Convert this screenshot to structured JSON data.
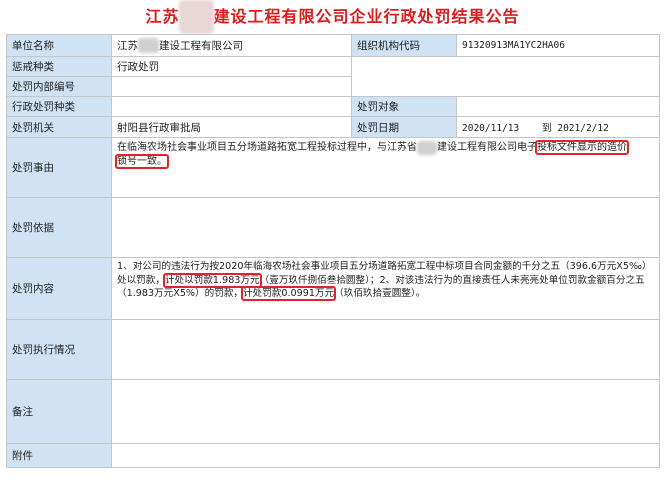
{
  "title": {
    "prefix": "江苏",
    "masked": "某某",
    "suffix": "建设工程有限公司企业行政处罚结果公告"
  },
  "rows": {
    "unit_name_label": "单位名称",
    "unit_name_prefix": "江苏",
    "unit_name_masked": "某某",
    "unit_name_suffix": "建设工程有限公司",
    "org_code_label": "组织机构代码",
    "org_code_value": "91320913MA1YC2HA06",
    "punish_type_label": "惩戒种类",
    "punish_type_value": "行政处罚",
    "internal_no_label": "处罚内部编号",
    "internal_no_value": "",
    "admin_type_label": "行政处罚种类",
    "admin_type_value": "",
    "target_label": "处罚对象",
    "target_value": "",
    "authority_label": "处罚机关",
    "authority_value": "射阳县行政审批局",
    "date_label": "处罚日期",
    "date_from": "2020/11/13",
    "date_sep": "到",
    "date_to": "2021/2/12",
    "reason_label": "处罚事由",
    "reason_text_a": "在临海农场社会事业项目五分场道路拓宽工程投标过程中，与江苏省",
    "reason_masked": "某某",
    "reason_text_b": "建设工程有限公司电子",
    "reason_hl1": "投标文件显示的造价",
    "reason_hl2": "锁号一致。",
    "basis_label": "处罚依据",
    "basis_value": "",
    "content_label": "处罚内容",
    "content_t1": "1、对公司的违法行为按2020年临海农场社会事业项目五分场道路拓宽工程中标项目合同金额的千分之五（396.6万元X5‰）处以罚款，",
    "content_hl1": "计处以罚款1.983万元",
    "content_t2": "（壹万玖仟捌佰叁拾圆整）；2、对该违法行为的直接责任人未亮亮处单位罚款金额百分之五（1.983万元X5%）的罚款，",
    "content_hl2": "计处罚款0.0991万元",
    "content_t3": "（玖佰玖拾壹圆整）。",
    "exec_label": "处罚执行情况",
    "exec_value": "",
    "remark_label": "备注",
    "remark_value": "",
    "attach_label": "附件",
    "attach_value": ""
  }
}
